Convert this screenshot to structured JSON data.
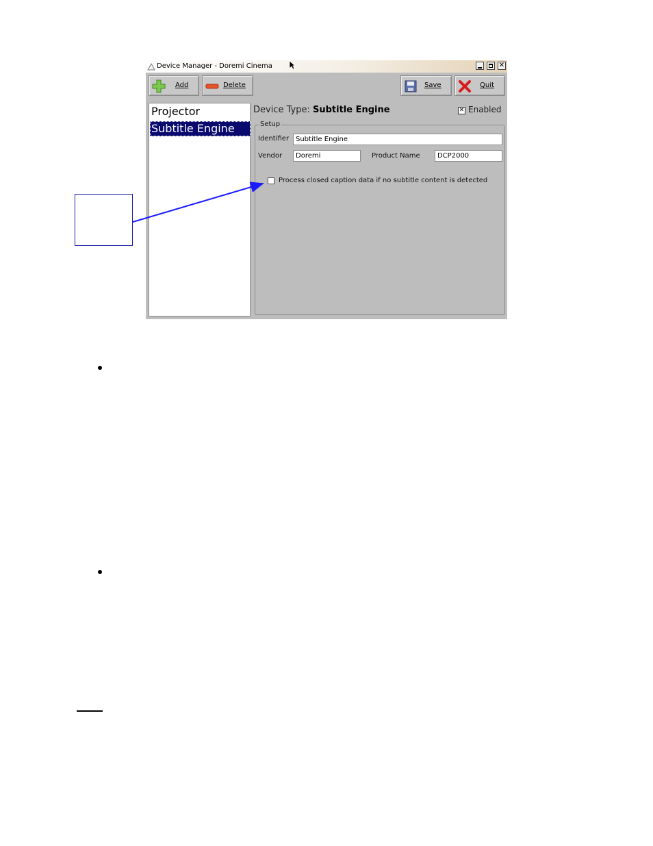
{
  "window": {
    "title": "Device Manager - Doremi Cinema"
  },
  "toolbar": {
    "add_label": "Add",
    "delete_label": "Delete",
    "save_label": "Save",
    "quit_label": "Quit"
  },
  "device_list": {
    "items": [
      {
        "label": "Projector",
        "selected": false
      },
      {
        "label": "Subtitle Engine",
        "selected": true
      }
    ]
  },
  "device": {
    "type_prefix": "Device Type:",
    "type_value": "Subtitle Engine",
    "enabled_label": "Enabled",
    "enabled": true
  },
  "setup": {
    "legend": "Setup",
    "identifier_label": "Identifier",
    "identifier_value": "Subtitle Engine",
    "vendor_label": "Vendor",
    "vendor_value": "Doremi",
    "product_label": "Product Name",
    "product_value": "DCP2000",
    "closed_caption_label": "Process closed caption data if no subtitle content is detected",
    "closed_caption_checked": false
  },
  "colors": {
    "selection": "#0a0a6e",
    "window_bg": "#bdbdbd",
    "callout": "#1a1aa8"
  }
}
